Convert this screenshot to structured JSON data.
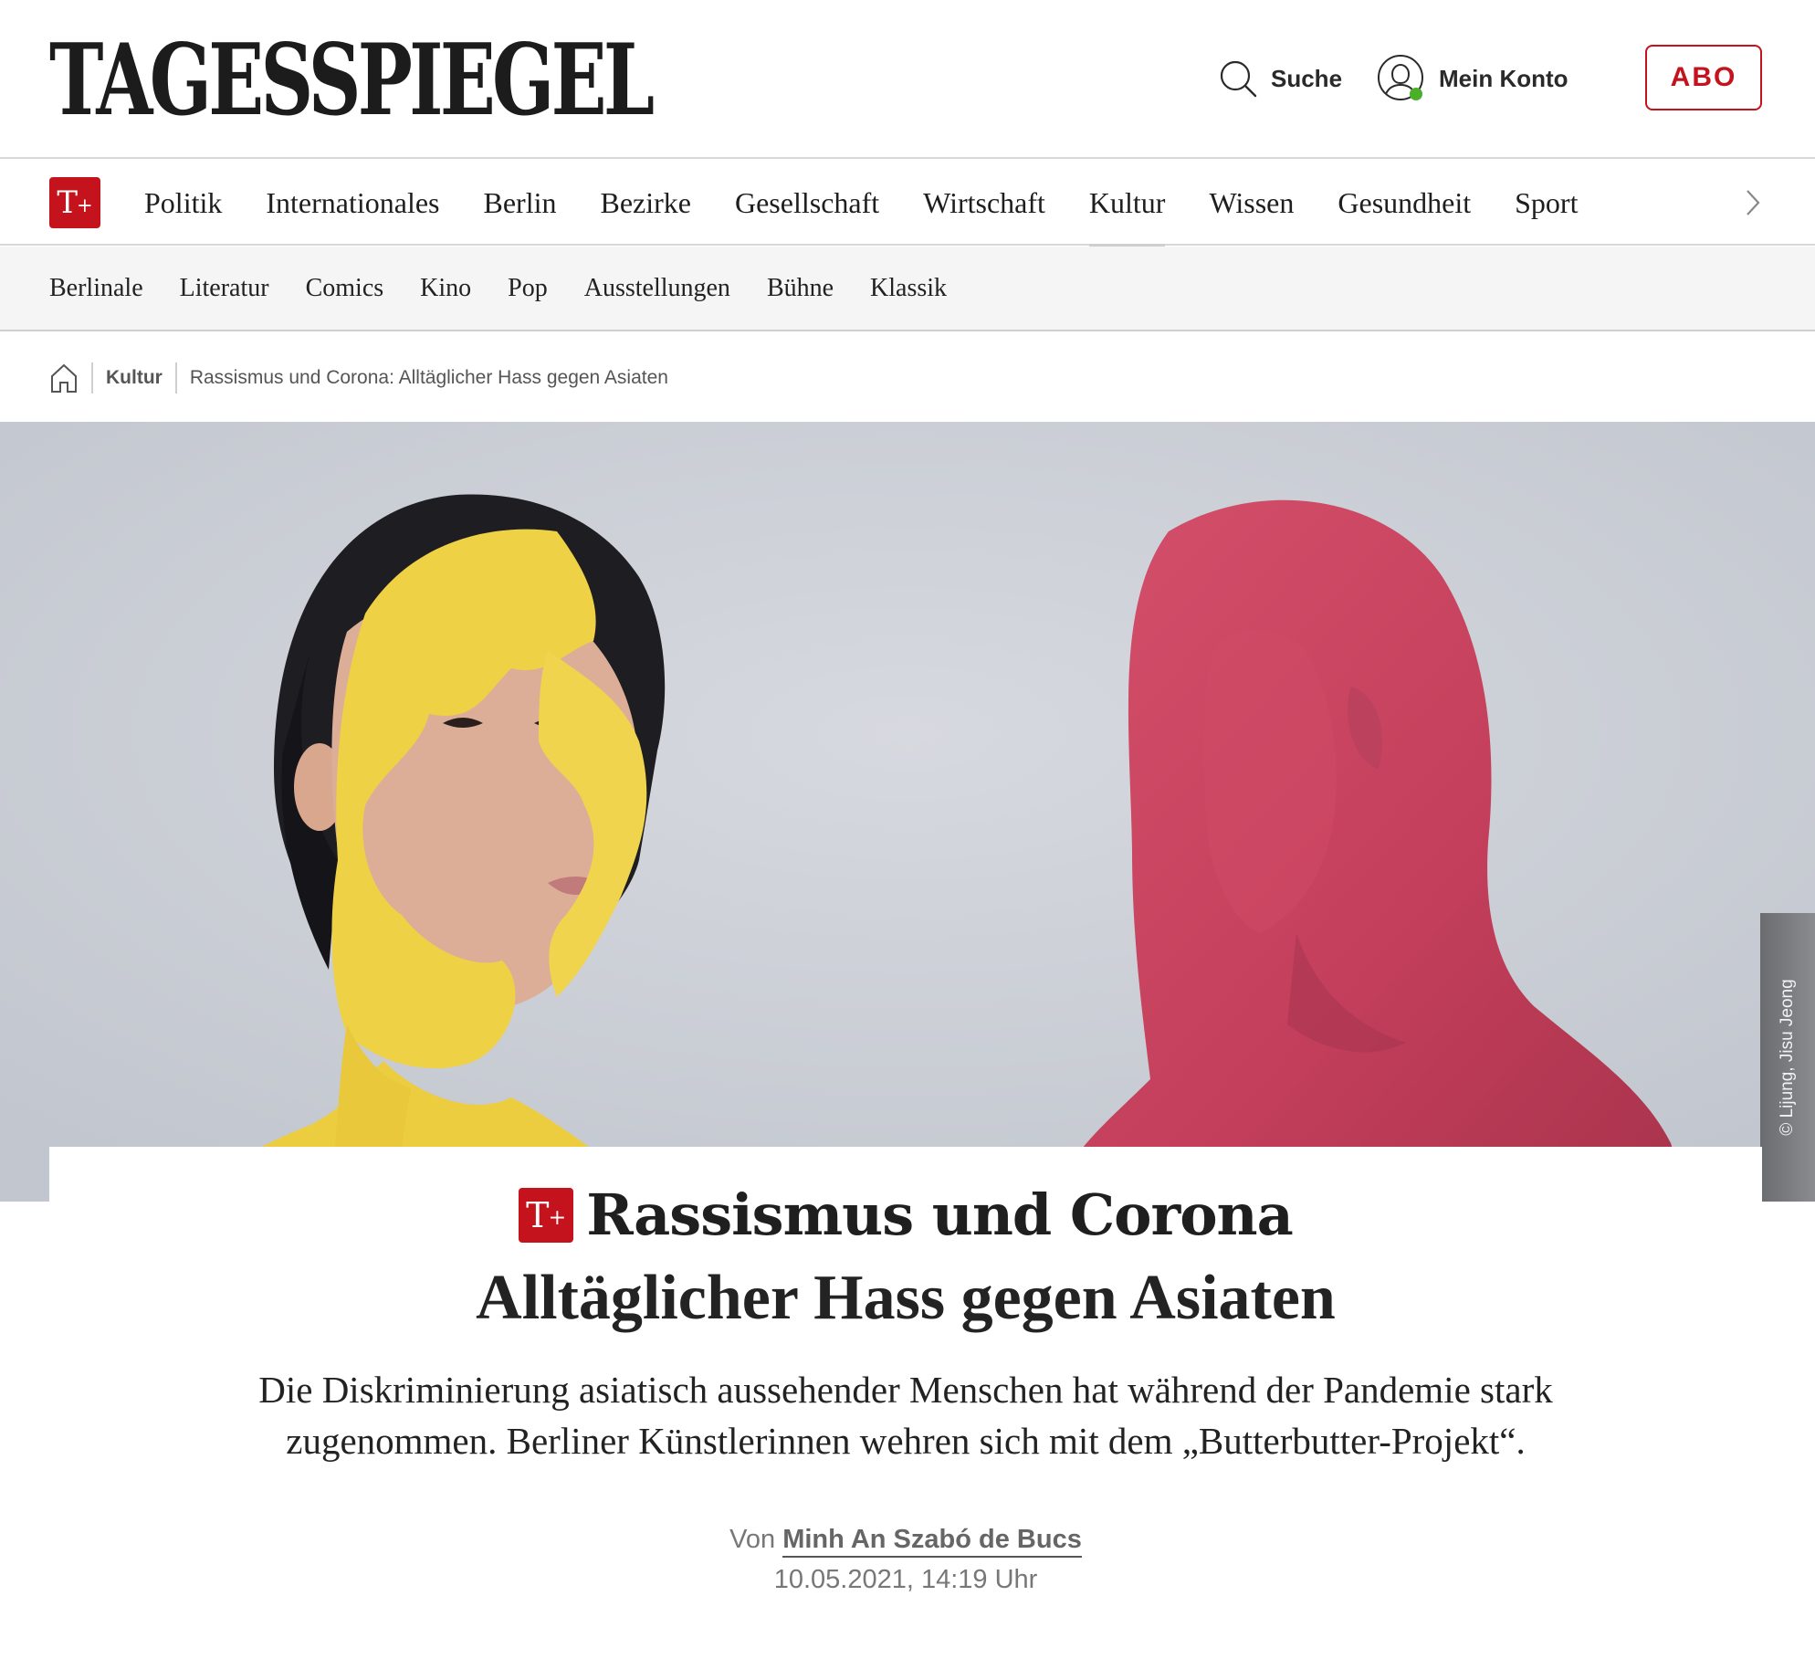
{
  "header": {
    "logo": "TAGESSPIEGEL",
    "search_label": "Suche",
    "account_label": "Mein Konto",
    "abo_label": "ABO"
  },
  "nav": {
    "plus_badge": "T",
    "plus_sign": "+",
    "items": [
      "Politik",
      "Internationales",
      "Berlin",
      "Bezirke",
      "Gesellschaft",
      "Wirtschaft",
      "Kultur",
      "Wissen",
      "Gesundheit",
      "Sport"
    ],
    "active": "Kultur"
  },
  "subnav": {
    "items": [
      "Berlinale",
      "Literatur",
      "Comics",
      "Kino",
      "Pop",
      "Ausstellungen",
      "Bühne",
      "Klassik"
    ]
  },
  "breadcrumb": {
    "section": "Kultur",
    "current": "Rassismus und Corona: Alltäglicher Hass gegen Asiaten"
  },
  "hero": {
    "credit": "© Lijung, Jisu Jeong"
  },
  "article": {
    "kicker": "Rassismus und Corona",
    "title": "Alltäglicher Hass gegen Asiaten",
    "teaser_line1": "Die Diskriminierung asiatisch aussehender Menschen hat während der Pandemie stark",
    "teaser_line2": "zugenommen. Berliner Künstlerinnen wehren sich mit dem „Butterbutter-Projekt“.",
    "byline_prefix": "Von",
    "author": "Minh An Szabó de Bucs",
    "date": "10.05.2021, 14:19 Uhr"
  },
  "colors": {
    "brand_red": "#c4131c",
    "online_dot": "#4caf2a"
  }
}
